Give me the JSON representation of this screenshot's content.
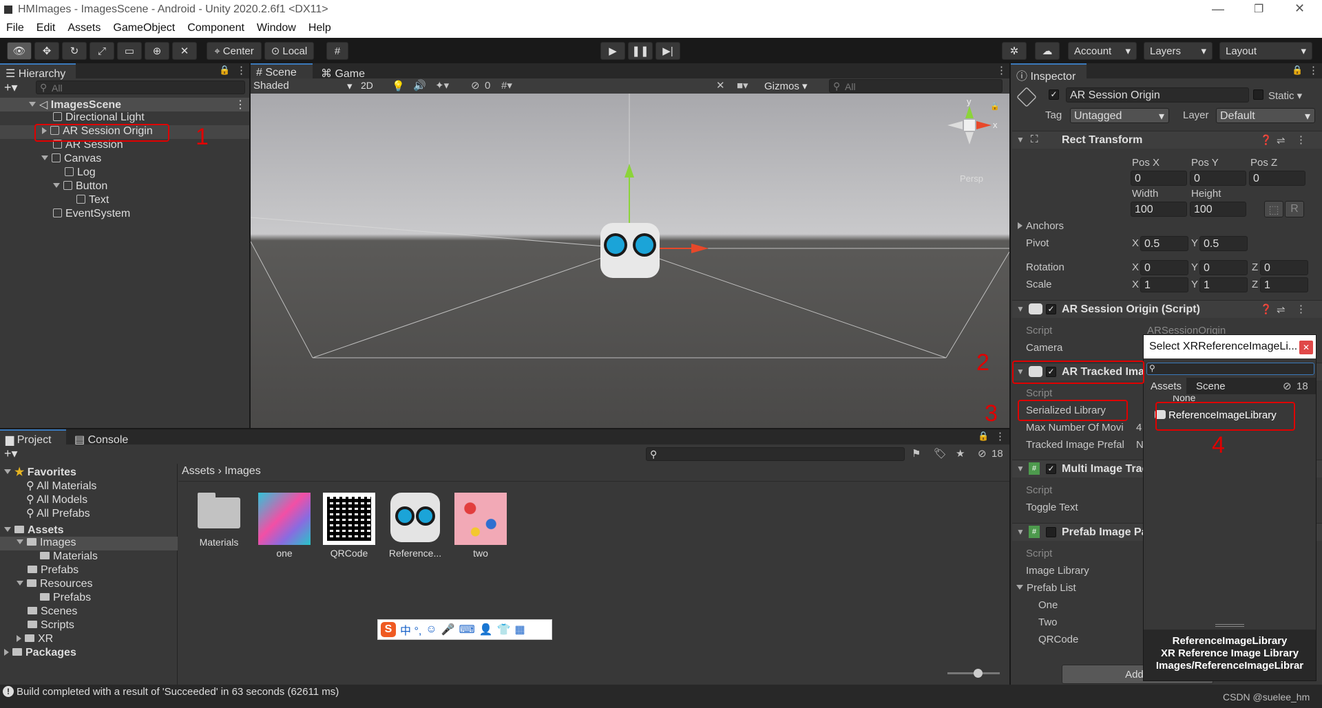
{
  "window": {
    "title": "HMImages - ImagesScene - Android - Unity 2020.2.6f1 <DX11>"
  },
  "menu": [
    "File",
    "Edit",
    "Assets",
    "GameObject",
    "Component",
    "Window",
    "Help"
  ],
  "toolbar": {
    "center": "Center",
    "local": "Local",
    "account": "Account",
    "layers": "Layers",
    "layout": "Layout"
  },
  "hierarchy": {
    "tab": "Hierarchy",
    "search_placeholder": "All",
    "scene": "ImagesScene",
    "items": [
      "Directional Light",
      "AR Session Origin",
      "AR Session",
      "Canvas",
      "Log",
      "Button",
      "Text",
      "EventSystem"
    ]
  },
  "scene_view": {
    "tab_scene": "Scene",
    "tab_game": "Game",
    "shading": "Shaded",
    "mode_2d": "2D",
    "hidden_count": "0",
    "gizmos": "Gizmos",
    "search_placeholder": "All",
    "persp": "Persp",
    "axis_x": "x",
    "axis_y": "y"
  },
  "project": {
    "tab_project": "Project",
    "tab_console": "Console",
    "favorites": "Favorites",
    "favorite_items": [
      "All Materials",
      "All Models",
      "All Prefabs"
    ],
    "assets": "Assets",
    "tree": [
      "Images",
      "Materials",
      "Prefabs",
      "Resources",
      "Prefabs",
      "Scenes",
      "Scripts",
      "XR"
    ],
    "packages": "Packages",
    "breadcrumb": [
      "Assets",
      "Images"
    ],
    "hidden_count": "18",
    "grid": [
      "Materials",
      "one",
      "QRCode",
      "Reference...",
      "two"
    ]
  },
  "inspector": {
    "tab": "Inspector",
    "object_name": "AR Session Origin",
    "static": "Static",
    "tag_label": "Tag",
    "tag": "Untagged",
    "layer_label": "Layer",
    "layer": "Default",
    "rect_transform": "Rect Transform",
    "pos_x_label": "Pos X",
    "pos_y_label": "Pos Y",
    "pos_z_label": "Pos Z",
    "pos_x": "0",
    "pos_y": "0",
    "pos_z": "0",
    "width_label": "Width",
    "height_label": "Height",
    "width": "100",
    "height": "100",
    "anchors": "Anchors",
    "pivot": "Pivot",
    "pivot_x": "0.5",
    "pivot_y": "0.5",
    "rotation": "Rotation",
    "rot_x": "0",
    "rot_y": "0",
    "rot_z": "0",
    "scale": "Scale",
    "scale_x": "1",
    "scale_y": "1",
    "scale_z": "1",
    "x": "X",
    "y": "Y",
    "z": "Z",
    "r": "R",
    "ar_session_origin": "AR Session Origin (Script)",
    "script": "Script",
    "script_value": "ARSessionOrigin",
    "camera": "Camera",
    "ar_tracked": "AR Tracked Ima",
    "serialized_library": "Serialized Library",
    "max_moving": "Max Number Of Movi",
    "max_moving_value": "4",
    "tracked_prefab": "Tracked Image Prefal",
    "tracked_prefab_value": "N",
    "multi_image": "Multi Image Trac",
    "toggle_text": "Toggle Text",
    "prefab_image": "Prefab Image Pa",
    "image_library": "Image Library",
    "prefab_list": "Prefab List",
    "prefabs": [
      "One",
      "Two",
      "QRCode"
    ],
    "add_button": "Add ("
  },
  "picker": {
    "title": "Select XRReferenceImageLi...",
    "tab_assets": "Assets",
    "tab_scene": "Scene",
    "hidden_count": "18",
    "items": [
      "None",
      "ReferenceImageLibrary"
    ],
    "info": [
      "ReferenceImageLibrary",
      "XR Reference Image Library",
      "Images/ReferenceImageLibrar"
    ]
  },
  "annotations": [
    "1",
    "2",
    "3",
    "4"
  ],
  "status": {
    "message": "Build completed with a result of 'Succeeded' in 63 seconds (62611 ms)",
    "watermark": "CSDN @suelee_hm"
  },
  "ime": {
    "text": "中 °, "
  }
}
